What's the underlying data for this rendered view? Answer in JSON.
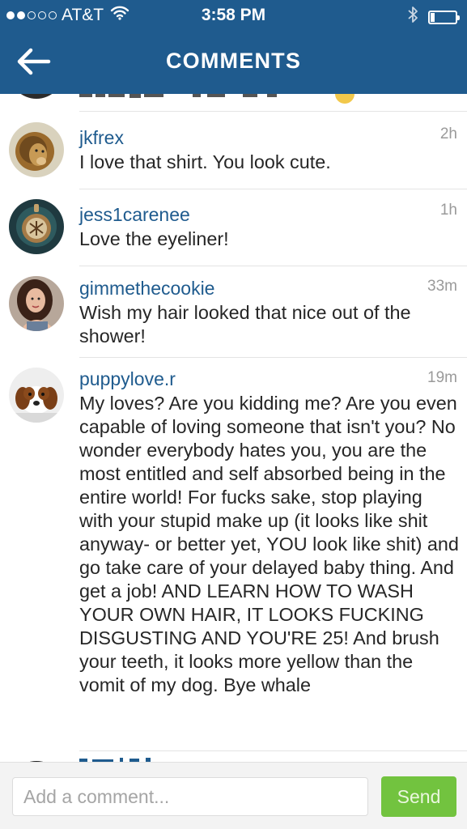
{
  "status_bar": {
    "carrier": "AT&T",
    "time": "3:58 PM",
    "signal_bars_filled": 2,
    "signal_bars_total": 5,
    "battery_level": 0.18
  },
  "nav": {
    "title": "COMMENTS",
    "back_icon": "arrow-left-icon"
  },
  "comments": [
    {
      "username": "jkfrex",
      "time": "2h",
      "text": "I love that shirt. You look cute.",
      "avatar": "lion"
    },
    {
      "username": "jess1carenee",
      "time": "1h",
      "text": "Love the eyeliner!",
      "avatar": "pendant"
    },
    {
      "username": "gimmethecookie",
      "time": "33m",
      "text": "Wish my hair looked that nice out of the shower!",
      "avatar": "girl"
    },
    {
      "username": "puppylove.r",
      "time": "19m",
      "text": "My loves? Are you kidding me? Are you even capable of loving someone that isn't you? No wonder everybody hates you, you are the most entitled and self absorbed being in the entire world! For fucks sake, stop playing with your stupid make up (it looks like shit anyway- or better yet, YOU look like shit) and go take care of your delayed baby thing. And get a job! AND LEARN HOW TO WASH YOUR OWN HAIR, IT LOOKS FUCKING DISGUSTING AND YOU'RE 25! And brush your teeth, it looks more yellow than the vomit of my dog. Bye whale",
      "avatar": "puppy"
    }
  ],
  "composer": {
    "placeholder": "Add a comment...",
    "send_label": "Send"
  },
  "colors": {
    "header_bg": "#1f5b8e",
    "username": "#1f5b8e",
    "send_bg": "#72c33f"
  }
}
